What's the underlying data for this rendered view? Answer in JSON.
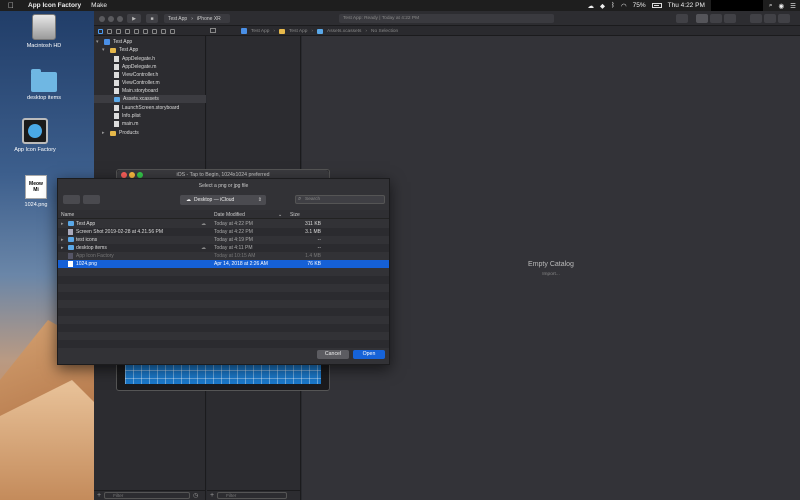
{
  "menubar": {
    "app_name": "App Icon Factory",
    "menu_make": "Make",
    "battery": "75%",
    "clock": "Thu 4:22 PM"
  },
  "desktop": {
    "icons": [
      {
        "label": "Macintosh HD"
      },
      {
        "label": "desktop items"
      },
      {
        "label": "App Icon Factory"
      },
      {
        "label": "1024.png"
      }
    ],
    "png_thumb_text": "Meow Mi"
  },
  "xcode": {
    "scheme": "Test App",
    "device": "iPhone XR",
    "status": "Test App: Ready | Today at 4:22 PM",
    "jumpbar": [
      "Test App",
      "Test App",
      "Assets.xcassets",
      "No Selection"
    ],
    "navigator_items": [
      {
        "label": "Test App",
        "kind": "project",
        "indent": 0
      },
      {
        "label": "Test App",
        "kind": "folder",
        "indent": 1
      },
      {
        "label": "AppDelegate.h",
        "kind": "file",
        "indent": 2
      },
      {
        "label": "AppDelegate.m",
        "kind": "file",
        "indent": 2
      },
      {
        "label": "ViewController.h",
        "kind": "file",
        "indent": 2
      },
      {
        "label": "ViewController.m",
        "kind": "file",
        "indent": 2
      },
      {
        "label": "Main.storyboard",
        "kind": "file",
        "indent": 2
      },
      {
        "label": "Assets.xcassets",
        "kind": "assets",
        "indent": 2,
        "selected": true
      },
      {
        "label": "LaunchScreen.storyboard",
        "kind": "file",
        "indent": 2
      },
      {
        "label": "Info.plist",
        "kind": "file",
        "indent": 2
      },
      {
        "label": "main.m",
        "kind": "file",
        "indent": 2
      },
      {
        "label": "Products",
        "kind": "folder",
        "indent": 1
      }
    ],
    "filter_placeholder": "Filter",
    "filter2_placeholder": "Filter",
    "empty_title": "Empty Catalog",
    "import_label": "Import..."
  },
  "aif_window": {
    "title": "iOS - Tap to Begin, 1024x1024 preferred"
  },
  "dialog": {
    "message": "Select a png or jpg file",
    "location": "Desktop — iCloud",
    "search_placeholder": "Search",
    "columns": {
      "name": "Name",
      "date": "Date Modified",
      "size": "Size"
    },
    "files": [
      {
        "name": "Test App",
        "date": "Today at 4:22 PM",
        "size": "311 KB",
        "kind": "folder",
        "expandable": true,
        "cloud": true
      },
      {
        "name": "Screen Shot 2019-02-28 at 4.21.56 PM",
        "date": "Today at 4:22 PM",
        "size": "3.1 MB",
        "kind": "image"
      },
      {
        "name": "test icons",
        "date": "Today at 4:19 PM",
        "size": "--",
        "kind": "folder",
        "expandable": true
      },
      {
        "name": "desktop items",
        "date": "Today at 4:11 PM",
        "size": "--",
        "kind": "folder",
        "expandable": true,
        "cloud": true
      },
      {
        "name": "App Icon Factory",
        "date": "Today at 10:15 AM",
        "size": "1.4 MB",
        "kind": "app",
        "dimmed": true
      },
      {
        "name": "1024.png",
        "date": "Apr 14, 2018 at 2:26 AM",
        "size": "76 KB",
        "kind": "image",
        "selected": true
      }
    ],
    "cancel_label": "Cancel",
    "open_label": "Open"
  }
}
